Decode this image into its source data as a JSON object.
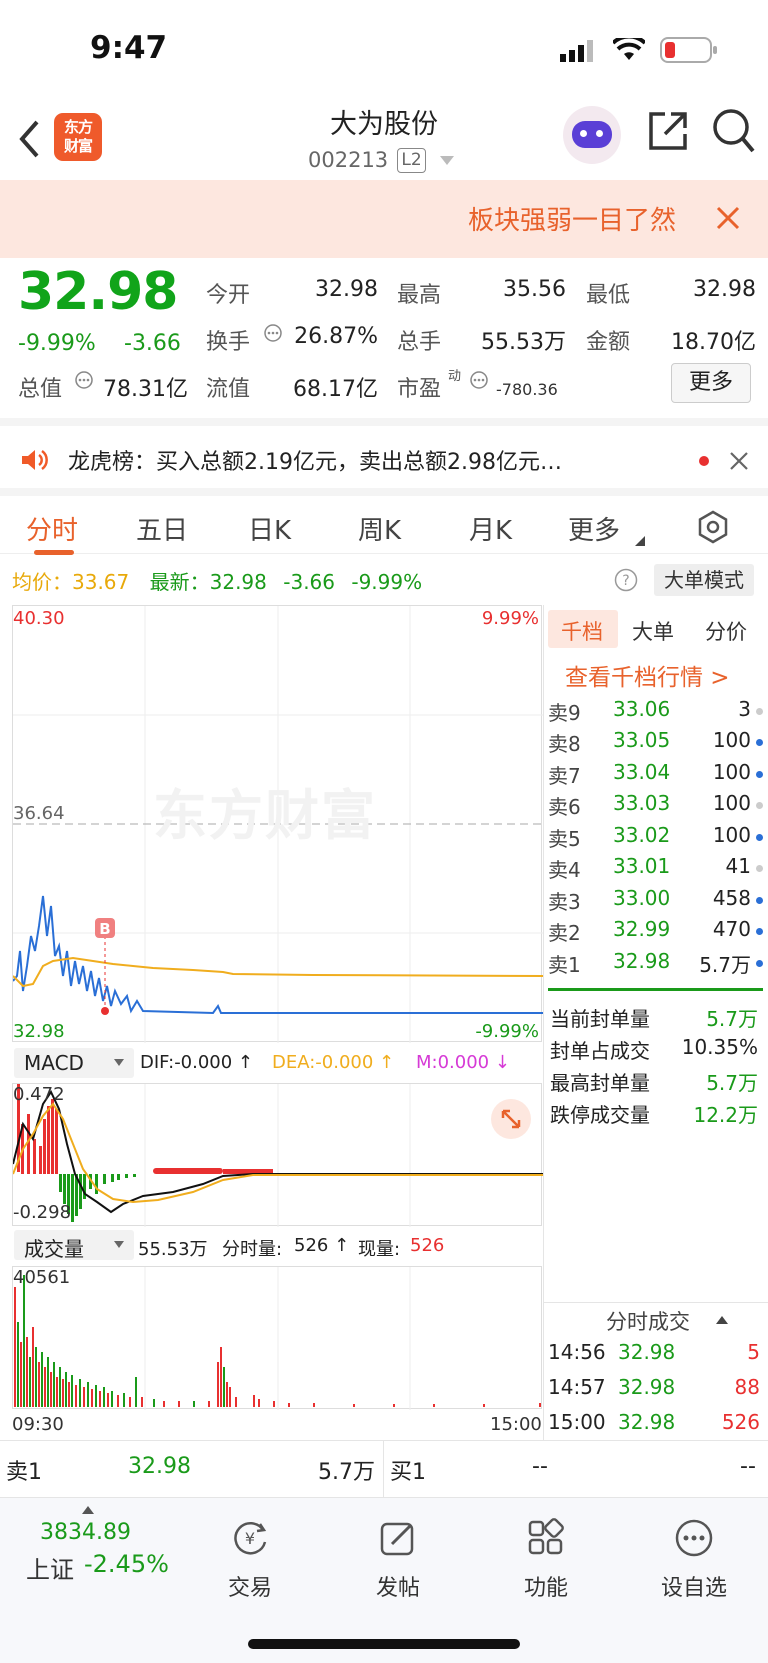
{
  "status": {
    "time": "9:47"
  },
  "nav": {
    "logo_text": "东方财富",
    "title": "大为股份",
    "code": "002213",
    "level": "L2"
  },
  "banner": {
    "text": "板块强弱一目了然"
  },
  "quote": {
    "price": "32.98",
    "change_pct": "-9.99%",
    "change": "-3.66",
    "open_label": "今开",
    "open": "32.98",
    "high_label": "最高",
    "high": "35.56",
    "low_label": "最低",
    "low": "32.98",
    "turnover_label": "换手",
    "turnover": "26.87%",
    "volume_label": "总手",
    "volume": "55.53万",
    "amount_label": "金额",
    "amount": "18.70亿",
    "mktcap_label": "总值",
    "mktcap": "78.31亿",
    "float_label": "流值",
    "float": "68.17亿",
    "pe_label": "市盈",
    "pe_sup": "动",
    "pe": "-780.36",
    "more": "更多"
  },
  "notice": {
    "text": "龙虎榜：买入总额2.19亿元，卖出总额2.98亿元…"
  },
  "tabs": [
    "分时",
    "五日",
    "日K",
    "周K",
    "月K",
    "更多"
  ],
  "avg": {
    "avg_label": "均价：",
    "avg": "33.67",
    "latest_label": "最新：",
    "latest": "32.98",
    "chg": "-3.66",
    "pct": "-9.99%",
    "mode_btn": "大单模式"
  },
  "chart": {
    "y_top": "40.30",
    "pct_top": "9.99%",
    "y_mid": "36.64",
    "y_bot": "32.98",
    "pct_bot": "-9.99%",
    "watermark": "东方财富"
  },
  "macd": {
    "label": "MACD",
    "dif": "DIF:-0.000 ↑",
    "dea": "DEA:-0.000 ↑",
    "m": "M:0.000 ↓",
    "y_top": "0.472",
    "y_bot": "-0.298"
  },
  "vol": {
    "label": "成交量",
    "total": "55.53万",
    "fen_label": "分时量:",
    "fen": "526 ↑",
    "now_label": "现量:",
    "now": "526",
    "y_top": "40561",
    "t_start": "09:30",
    "t_end": "15:00"
  },
  "side_tabs": [
    "千档",
    "大单",
    "分价"
  ],
  "side_link": "查看千档行情 >",
  "orderbook": [
    {
      "label": "卖9",
      "price": "33.06",
      "qty": "3",
      "dot": "#ccc"
    },
    {
      "label": "卖8",
      "price": "33.05",
      "qty": "100",
      "dot": "#2a6fd6"
    },
    {
      "label": "卖7",
      "price": "33.04",
      "qty": "100",
      "dot": "#2a6fd6"
    },
    {
      "label": "卖6",
      "price": "33.03",
      "qty": "100",
      "dot": "#ccc"
    },
    {
      "label": "卖5",
      "price": "33.02",
      "qty": "100",
      "dot": "#2a6fd6"
    },
    {
      "label": "卖4",
      "price": "33.01",
      "qty": "41",
      "dot": "#ccc"
    },
    {
      "label": "卖3",
      "price": "33.00",
      "qty": "458",
      "dot": "#2a6fd6"
    },
    {
      "label": "卖2",
      "price": "32.99",
      "qty": "470",
      "dot": "#2a6fd6"
    },
    {
      "label": "卖1",
      "price": "32.98",
      "qty": "5.7万",
      "dot": "#2a6fd6"
    }
  ],
  "seal": [
    {
      "label": "当前封单量",
      "val": "5.7万"
    },
    {
      "label": "封单占成交",
      "val": "10.35%"
    },
    {
      "label": "最高封单量",
      "val": "5.7万"
    },
    {
      "label": "跌停成交量",
      "val": "12.2万"
    }
  ],
  "ticks_title": "分时成交",
  "ticks": [
    {
      "t": "14:56",
      "p": "32.98",
      "v": "5"
    },
    {
      "t": "14:57",
      "p": "32.98",
      "v": "88"
    },
    {
      "t": "15:00",
      "p": "32.98",
      "v": "526"
    }
  ],
  "bar": {
    "sell_label": "卖1",
    "sell_price": "32.98",
    "sell_vol": "5.7万",
    "buy_label": "买1",
    "buy_price": "--",
    "buy_vol": "--"
  },
  "bottom": {
    "index_value": "3834.89",
    "index_name": "上证",
    "index_pct": "-2.45%",
    "items": [
      "交易",
      "发帖",
      "功能",
      "设自选"
    ]
  }
}
